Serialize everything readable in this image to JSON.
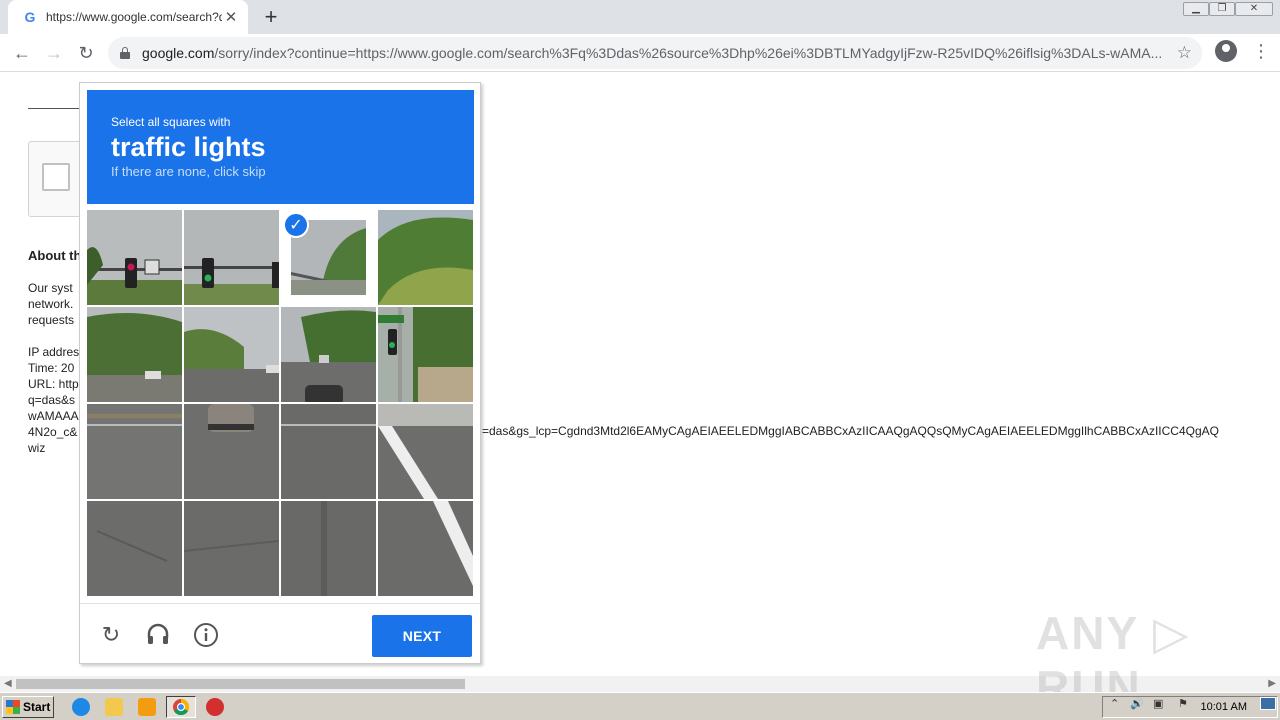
{
  "browser": {
    "tab_title": "https://www.google.com/search?q=",
    "tab_close": "✕",
    "new_tab": "+",
    "url_host": "google.com",
    "url_rest": "/sorry/index?continue=https://www.google.com/search%3Fq%3Ddas%26source%3Dhp%26ei%3DBTLMYadgyIjFzw-R25vIDQ%26iflsig%3DALs-wAMA..."
  },
  "page": {
    "about_heading": "About th",
    "body_lines": "Our syst\nnetwork. \nrequests",
    "details_lines": "IP addres\nTime: 20\nURL: http\nq=das&s\nwAMAAA\n4N2o_c&\nwiz",
    "long_url_tail": "=das&gs_lcp=Cgdnd3Mtd2l6EAMyCAgAEIAEELEDMggIABCABBCxAzIICAAQgAQQsQMyCAgAEIAEELEDMggIlhCABBCxAzIICC4QgAQ"
  },
  "captcha": {
    "instruction": "Select all squares with",
    "target": "traffic lights",
    "hint": "If there are none, click skip",
    "next_label": "NEXT",
    "selected_tiles": [
      2
    ]
  },
  "watermark": "ANY ▷ RUN",
  "taskbar": {
    "start_label": "Start",
    "clock": "10:01 AM"
  }
}
